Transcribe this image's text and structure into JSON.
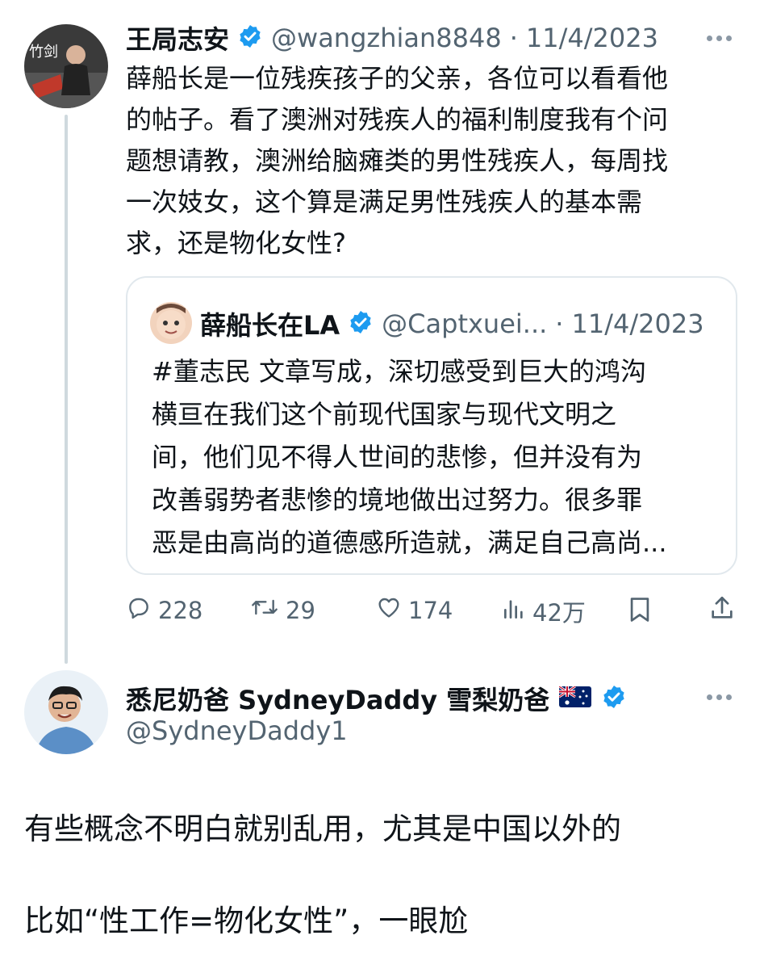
{
  "tweet1": {
    "name": "王局志安",
    "handle": "@wangzhian8848",
    "date_sep": "·",
    "date": "11/4/2023",
    "text_lines": [
      "薛船长是一位残疾孩子的父亲，各位可以看看他",
      "的帖子。看了澳洲对残疾人的福利制度我有个问",
      "题想请教，澳洲给脑瘫类的男性残疾人，每周找",
      "一次妓女，这个算是满足男性残疾人的基本需",
      "求，还是物化女性?"
    ]
  },
  "quote": {
    "name": "薛船长在LA",
    "handle": "@Captxuei...",
    "date_sep": "·",
    "date": "11/4/2023",
    "text_lines": [
      "#董志民 文章写成，深切感受到巨大的鸿沟",
      "横亘在我们这个前现代国家与现代文明之",
      "间，他们见不得人世间的悲惨，但并没有为",
      "改善弱势者悲惨的境地做出过努力。很多罪",
      "恶是由高尚的道德感所造就，满足自己高尚..."
    ]
  },
  "actions": {
    "replies": "228",
    "retweets": "29",
    "likes": "174",
    "views": "42万"
  },
  "tweet2": {
    "name": "悉尼奶爸 SydneyDaddy 雪梨奶爸",
    "handle": "@SydneyDaddy1",
    "text_line1": "有些概念不明白就别乱用，尤其是中国以外的",
    "text_line2": "比如“性工作=物化女性”，一眼尬"
  },
  "colors": {
    "verified": "#1d9bf0",
    "muted": "#536471",
    "thread_line": "#cfd9de"
  },
  "icons": [
    "reply-icon",
    "retweet-icon",
    "like-icon",
    "views-icon",
    "bookmark-icon",
    "share-icon",
    "verified-badge-icon",
    "more-icon",
    "australia-flag-icon"
  ]
}
